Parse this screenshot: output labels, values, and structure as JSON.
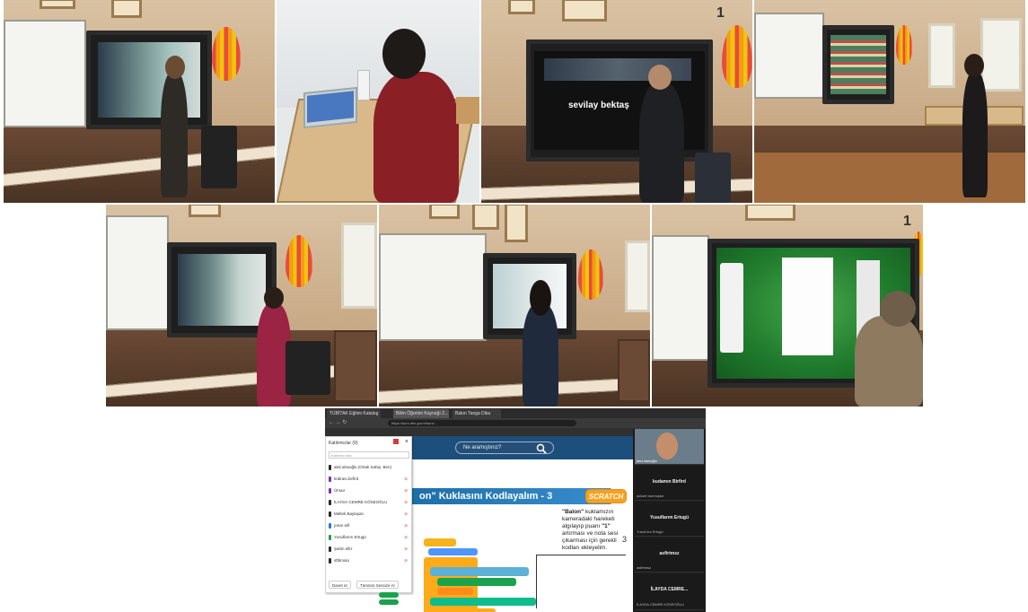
{
  "photos": {
    "p3_screen_text": "sevilay bektaş",
    "balloon_number": "1"
  },
  "browser": {
    "tabs": [
      "TÜBİTAK Eğitim Katalog",
      "Bilim Öğretim Kaynağı 2...",
      "Balon Tanga Dika"
    ],
    "address": "https://kurs.dbs.gov.tr/kurs/..."
  },
  "site": {
    "search_placeholder": "Ne aramıştınız?",
    "search_icon": "magnifier-icon",
    "slide_title": "on\" Kuklasını Kodlayalım - 3",
    "scratch_logo": "SCRATCH",
    "step_number": "3",
    "description_bold_1": "\"Balon\"",
    "description_1": " kuklamızın kameradaki hareketi algılayıp puanı ",
    "description_bold_2": "\"1\"",
    "description_2": " artırması ve nota sesi çıkarması için gerekli kodları ekleyelim."
  },
  "participants_panel": {
    "header": "Katılımcılar (9)",
    "search_placeholder": "Katılımcı ara",
    "rows": [
      {
        "name": "abd.ulasoğlu (Ortak Sahip, Ben)",
        "color": "#2a2a2a"
      },
      {
        "name": "kübrası.birfird",
        "color": "#7b2fbe"
      },
      {
        "name": "Ümaır",
        "color": "#7b2fbe"
      },
      {
        "name": "İLAYDA CEMRE KÖSEOĞLU",
        "color": "#2a2a2a"
      },
      {
        "name": "Meltek Baylaşan",
        "color": "#2a2a2a"
      },
      {
        "name": "pınar elif",
        "color": "#2a7bd6"
      },
      {
        "name": "Yusuflarım Ertugü",
        "color": "#1aa34a"
      },
      {
        "name": "Şahin elliz",
        "color": "#2a2a2a"
      },
      {
        "name": "sftbmsia",
        "color": "#2a2a2a"
      }
    ],
    "buttons": [
      "Davet et",
      "Tümünü Sessize Al"
    ]
  },
  "video_tiles": [
    {
      "name": "abd.ulasoğlu",
      "sub": ""
    },
    {
      "name": "kudamın Birfird",
      "sub": "yuksel durmuştur"
    },
    {
      "name": "Yusuflarım Ertugü",
      "sub": "Yusuf.ürs Ertugü"
    },
    {
      "name": "asfirtmsz",
      "sub": "asfirtmsz"
    },
    {
      "name": "İLAYDA CEMRE...",
      "sub": "İLAYDA CEMRE KÖSEOĞLU"
    }
  ],
  "colors": {
    "site_nav": "#1d4f7c",
    "banner": "#1d6fa8",
    "scratch": "#f7a11f"
  }
}
